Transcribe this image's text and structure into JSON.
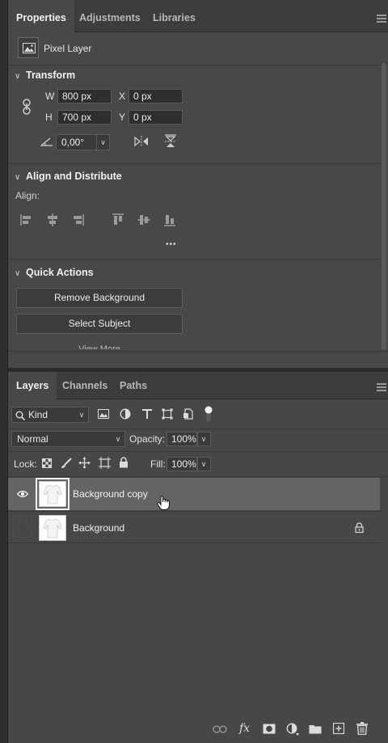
{
  "properties_panel": {
    "tabs": [
      {
        "label": "Properties",
        "active": true
      },
      {
        "label": "Adjustments",
        "active": false
      },
      {
        "label": "Libraries",
        "active": false
      }
    ],
    "layer_kind_icon": "pixel-layer-icon",
    "layer_kind": "Pixel Layer",
    "transform": {
      "title": "Transform",
      "w_label": "W",
      "w_value": "800 px",
      "x_label": "X",
      "x_value": "0 px",
      "h_label": "H",
      "h_value": "700 px",
      "y_label": "Y",
      "y_value": "0 px",
      "angle_value": "0,00°"
    },
    "align": {
      "title": "Align and Distribute",
      "label": "Align:",
      "more": "•••"
    },
    "quick_actions": {
      "title": "Quick Actions",
      "remove_bg": "Remove Background",
      "select_subject": "Select Subject",
      "view_more": "View More"
    }
  },
  "layers_panel": {
    "tabs": [
      {
        "label": "Layers",
        "active": true
      },
      {
        "label": "Channels",
        "active": false
      },
      {
        "label": "Paths",
        "active": false
      }
    ],
    "filter_kind": "Kind",
    "blend_mode": "Normal",
    "opacity_label": "Opacity:",
    "opacity_value": "100%",
    "lock_label": "Lock:",
    "fill_label": "Fill:",
    "fill_value": "100%",
    "layers": [
      {
        "name": "Background copy",
        "visible": true,
        "selected": true,
        "locked": false
      },
      {
        "name": "Background",
        "visible": false,
        "selected": false,
        "locked": true
      }
    ]
  },
  "colors": {
    "panel_bg": "#484848",
    "tab_bar_bg": "#3c3c3c",
    "selected_row": "#646464",
    "field_bg": "#2e2e2e"
  }
}
